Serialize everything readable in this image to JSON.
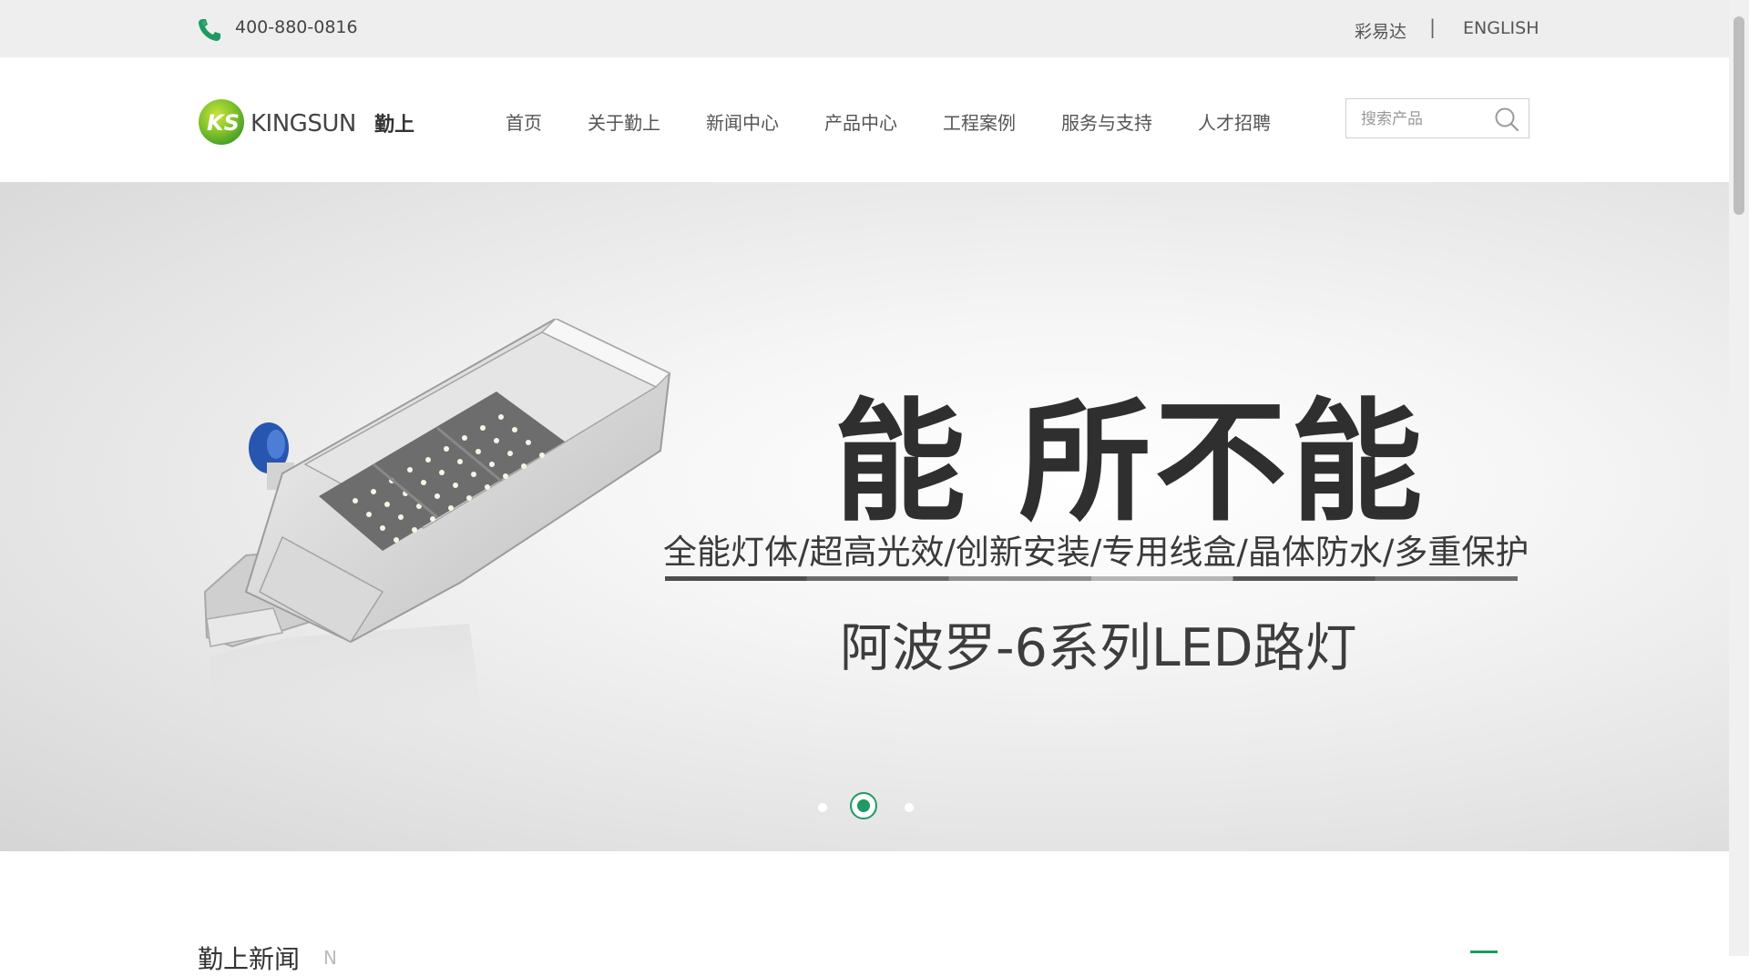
{
  "topbar": {
    "phone": "400-880-0816",
    "lang_cn": "彩易达",
    "separator": "|",
    "lang_en": "ENGLISH",
    "phone_icon": "phone-icon",
    "icon_color": "#1f9a63"
  },
  "header": {
    "logo_text": "KINGSUN 勤上",
    "nav": [
      {
        "label": "首页"
      },
      {
        "label": "关于勤上"
      },
      {
        "label": "新闻中心"
      },
      {
        "label": "产品中心"
      },
      {
        "label": "工程案例"
      },
      {
        "label": "服务与支持"
      },
      {
        "label": "人才招聘"
      }
    ],
    "search": {
      "placeholder": "搜索产品",
      "value": "",
      "icon": "search-icon"
    }
  },
  "banner": {
    "headline": "能 所不能",
    "features": "全能灯体/超高光效/创新安装/专用线盒/晶体防水/多重保护",
    "series": "阿波罗-6系列LED路灯",
    "active_slide": 2,
    "slide_count": 3,
    "accent_color": "#1f9a63"
  },
  "news": {
    "title": "勤上新闻",
    "subtitle": "N"
  }
}
